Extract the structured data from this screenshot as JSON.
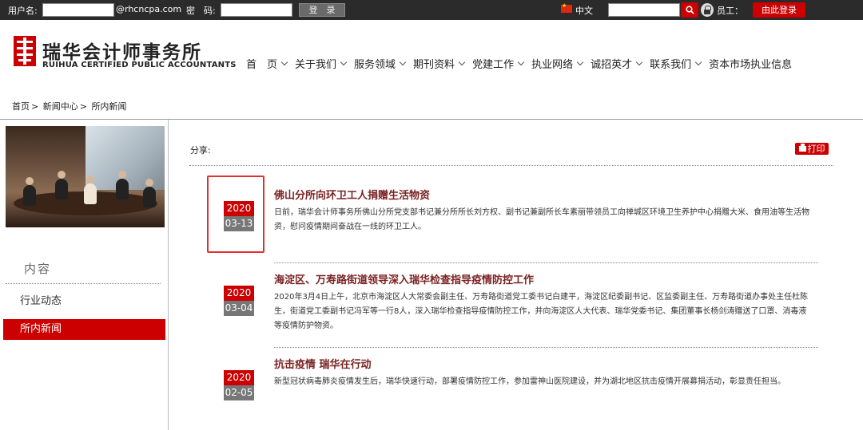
{
  "topbar": {
    "username_label": "用户名:",
    "domain_suffix": "@rhcncpa.com",
    "password_label": "密　码:",
    "login_button": "登　录",
    "language": "中文",
    "staff_label": "员工：",
    "staff_login_button": "由此登录"
  },
  "logo": {
    "cn": "瑞华会计师事务所",
    "en": "RUIHUA CERTIFIED PUBLIC ACCOUNTANTS"
  },
  "nav": [
    "首　页",
    "关于我们",
    "服务领域",
    "期刊资料",
    "党建工作",
    "执业网络",
    "诚招英才",
    "联系我们",
    "资本市场执业信息"
  ],
  "breadcrumb": [
    "首页",
    "新闻中心",
    "所内新闻"
  ],
  "sidebar": {
    "title": "内容",
    "items": [
      "行业动态",
      "所内新闻"
    ]
  },
  "main": {
    "share_label": "分享:",
    "print_label": "打印",
    "news": [
      {
        "year": "2020",
        "md": "03-13",
        "title": "佛山分所向环卫工人捐赠生活物资",
        "summary": "日前，瑞华会计师事务所佛山分所党支部书记兼分所所长刘方权、副书记兼副所长车素丽带领员工向禅城区环境卫生养护中心捐赠大米、食用油等生活物资，慰问疫情期间奋战在一线的环卫工人。"
      },
      {
        "year": "2020",
        "md": "03-04",
        "title": "海淀区、万寿路街道领导深入瑞华检查指导疫情防控工作",
        "summary": "2020年3月4日上午，北京市海淀区人大常委会副主任、万寿路街道党工委书记白建平，海淀区纪委副书记、区监委副主任、万寿路街道办事处主任杜陈生，街道党工委副书记冯军等一行8人，深入瑞华检查指导疫情防控工作，并向海淀区人大代表、瑞华党委书记、集团董事长杨剑涛赠送了口罩、消毒液等疫情防护物资。"
      },
      {
        "year": "2020",
        "md": "02-05",
        "title": "抗击疫情 瑞华在行动",
        "summary": "新型冠状病毒肺炎疫情发生后，瑞华快速行动，部署疫情防控工作，参加雷神山医院建设，并为湖北地区抗击疫情开展募捐活动，彰显责任担当。"
      }
    ]
  },
  "colors": {
    "brand_red": "#cc0000",
    "topbar_bg": "#2b2b2b",
    "highlight": "#e32f2f"
  }
}
